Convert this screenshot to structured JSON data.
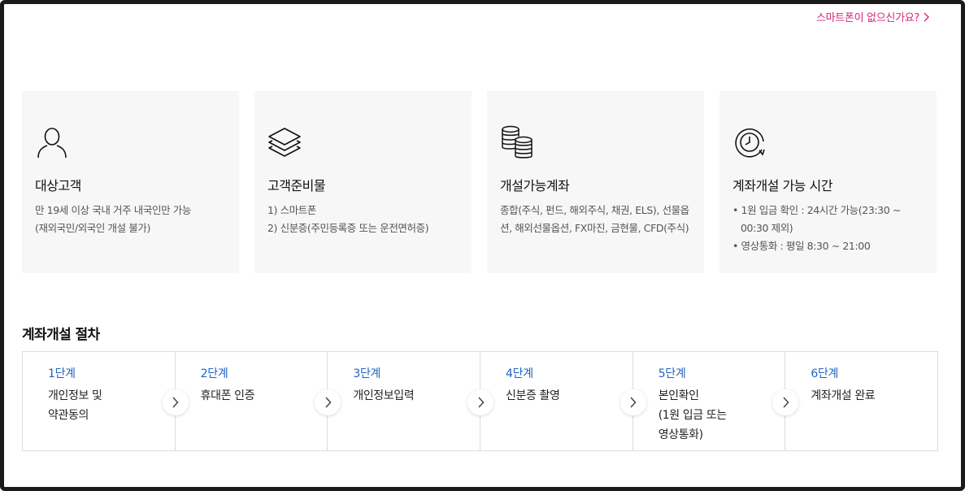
{
  "top_link": {
    "label": "스마트폰이 없으신가요?"
  },
  "cards": [
    {
      "icon": "person-icon",
      "title": "대상고객",
      "lines": [
        "만 19세 이상 국내 거주 내국인만 가능",
        "(재외국민/외국인 개설 불가)"
      ]
    },
    {
      "icon": "layers-icon",
      "title": "고객준비물",
      "lines": [
        "1) 스마트폰",
        "2) 신분증(주민등록증 또는 운전면허증)"
      ]
    },
    {
      "icon": "coins-icon",
      "title": "개설가능계좌",
      "lines": [
        "종합(주식, 펀드, 해외주식, 채권, ELS), 선물옵션, 해외선물옵션, FX마진, 금현물, CFD(주식)"
      ]
    },
    {
      "icon": "clock-icon",
      "title": "계좌개설 가능 시간",
      "bullets": [
        "1원 입금 확인 : 24시간 가능(23:30 ~ 00:30 제외)",
        "영상통화 : 평일 8:30 ~ 21:00"
      ]
    }
  ],
  "procedure": {
    "title": "계좌개설 절차",
    "steps": [
      {
        "num": "1단계",
        "label": "개인정보 및\n약관동의"
      },
      {
        "num": "2단계",
        "label": "휴대폰 인증"
      },
      {
        "num": "3단계",
        "label": "개인정보입력"
      },
      {
        "num": "4단계",
        "label": "신분증 촬영"
      },
      {
        "num": "5단계",
        "label": "본인확인\n(1원 입금 또는\n영상통화)"
      },
      {
        "num": "6단계",
        "label": "계좌개설 완료"
      }
    ]
  },
  "colors": {
    "link": "#d6247e",
    "step_num": "#1f64c4",
    "card_bg": "#f7f7f7"
  }
}
